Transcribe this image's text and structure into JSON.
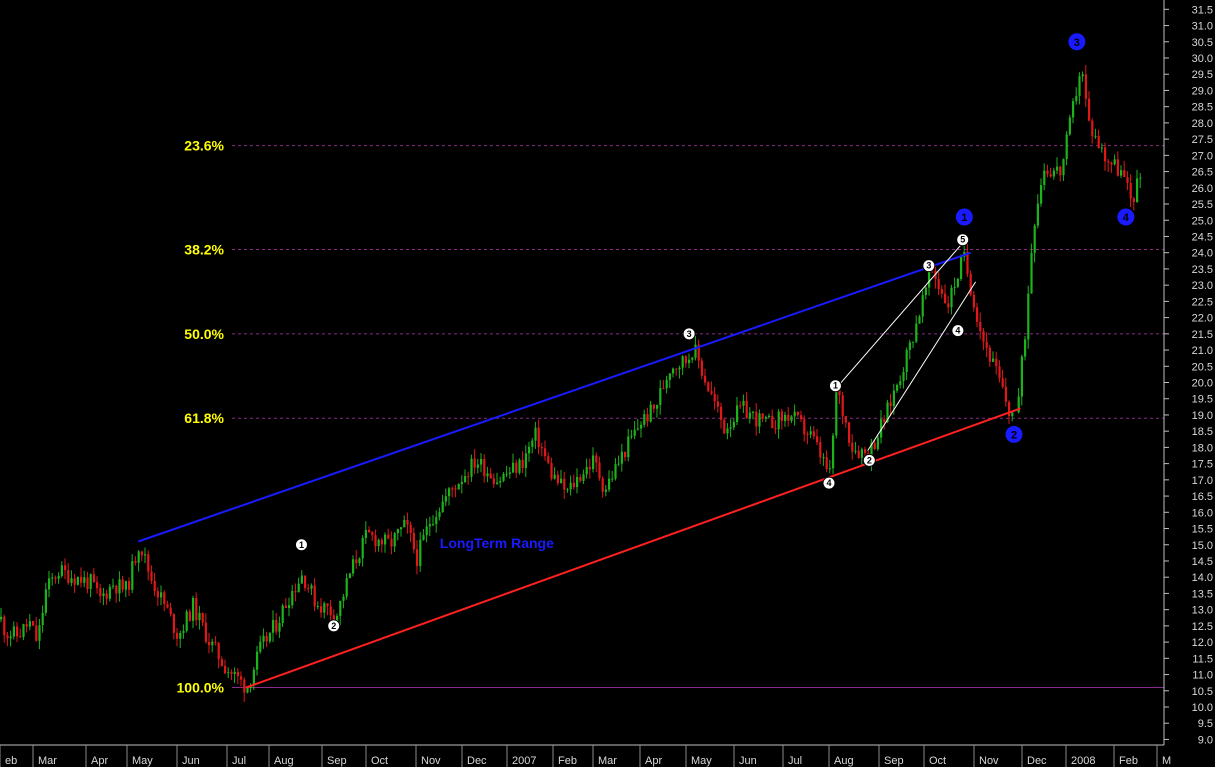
{
  "chart_data": {
    "type": "candlestick",
    "y_axis": {
      "ylim": [
        8.7,
        31.6
      ],
      "tick_labels": [
        "9.0",
        "9.5",
        "10.0",
        "10.5",
        "11.0",
        "11.5",
        "12.0",
        "12.5",
        "13.0",
        "13.5",
        "14.0",
        "14.5",
        "15.0",
        "15.5",
        "16.0",
        "16.5",
        "17.0",
        "17.5",
        "18.0",
        "18.5",
        "19.0",
        "19.5",
        "20.0",
        "20.5",
        "21.0",
        "21.5",
        "22.0",
        "22.5",
        "23.0",
        "23.5",
        "24.0",
        "24.5",
        "25.0",
        "25.5",
        "26.0",
        "26.5",
        "27.0",
        "27.5",
        "28.0",
        "28.5",
        "29.0",
        "29.5",
        "30.0",
        "30.5",
        "31.0",
        "31.5"
      ],
      "position": "right"
    },
    "x_axis": {
      "tick_labels": [
        {
          "label": "eb",
          "date": "2006-02-01"
        },
        {
          "label": "Mar",
          "date": "2006-03-01"
        },
        {
          "label": "Apr",
          "date": "2006-04-01"
        },
        {
          "label": "May",
          "date": "2006-05-01"
        },
        {
          "label": "Jun",
          "date": "2006-06-01"
        },
        {
          "label": "Jul",
          "date": "2006-07-01"
        },
        {
          "label": "Aug",
          "date": "2006-08-01"
        },
        {
          "label": "Sep",
          "date": "2006-09-01"
        },
        {
          "label": "Oct",
          "date": "2006-10-01"
        },
        {
          "label": "Nov",
          "date": "2006-11-01"
        },
        {
          "label": "Dec",
          "date": "2006-12-01"
        },
        {
          "label": "2007",
          "date": "2007-01-01"
        },
        {
          "label": "Feb",
          "date": "2007-02-01"
        },
        {
          "label": "Mar",
          "date": "2007-03-01"
        },
        {
          "label": "Apr",
          "date": "2007-04-01"
        },
        {
          "label": "May",
          "date": "2007-05-01"
        },
        {
          "label": "Jun",
          "date": "2007-06-01"
        },
        {
          "label": "Jul",
          "date": "2007-07-01"
        },
        {
          "label": "Aug",
          "date": "2007-08-01"
        },
        {
          "label": "Sep",
          "date": "2007-09-01"
        },
        {
          "label": "Oct",
          "date": "2007-10-01"
        },
        {
          "label": "Nov",
          "date": "2007-11-01"
        },
        {
          "label": "Dec",
          "date": "2007-12-01"
        },
        {
          "label": "2008",
          "date": "2008-01-01"
        },
        {
          "label": "Feb",
          "date": "2008-02-01"
        },
        {
          "label": "M",
          "date": "2008-03-01"
        }
      ]
    },
    "price_path": [
      {
        "date": "2006-01-20",
        "price": 14.0
      },
      {
        "date": "2006-01-27",
        "price": 13.0
      },
      {
        "date": "2006-02-05",
        "price": 12.3
      },
      {
        "date": "2006-02-15",
        "price": 12.2
      },
      {
        "date": "2006-02-25",
        "price": 12.6
      },
      {
        "date": "2006-03-03",
        "price": 12.0
      },
      {
        "date": "2006-03-08",
        "price": 13.6
      },
      {
        "date": "2006-03-15",
        "price": 14.2
      },
      {
        "date": "2006-03-25",
        "price": 14.0
      },
      {
        "date": "2006-04-05",
        "price": 13.8
      },
      {
        "date": "2006-04-10",
        "price": 13.3
      },
      {
        "date": "2006-04-20",
        "price": 13.8
      },
      {
        "date": "2006-04-30",
        "price": 13.6
      },
      {
        "date": "2006-05-08",
        "price": 15.1
      },
      {
        "date": "2006-05-15",
        "price": 14.0
      },
      {
        "date": "2006-05-25",
        "price": 13.0
      },
      {
        "date": "2006-06-01",
        "price": 12.2
      },
      {
        "date": "2006-06-10",
        "price": 13.1
      },
      {
        "date": "2006-06-20",
        "price": 12.0
      },
      {
        "date": "2006-06-30",
        "price": 11.2
      },
      {
        "date": "2006-07-10",
        "price": 10.8
      },
      {
        "date": "2006-07-15",
        "price": 10.6
      },
      {
        "date": "2006-07-25",
        "price": 11.8
      },
      {
        "date": "2006-08-05",
        "price": 12.6
      },
      {
        "date": "2006-08-12",
        "price": 13.4
      },
      {
        "date": "2006-08-20",
        "price": 14.1
      },
      {
        "date": "2006-08-28",
        "price": 13.2
      },
      {
        "date": "2006-09-05",
        "price": 13.0
      },
      {
        "date": "2006-09-10",
        "price": 12.8
      },
      {
        "date": "2006-09-20",
        "price": 14.2
      },
      {
        "date": "2006-10-01",
        "price": 15.3
      },
      {
        "date": "2006-10-15",
        "price": 15.0
      },
      {
        "date": "2006-10-25",
        "price": 15.6
      },
      {
        "date": "2006-11-01",
        "price": 14.6
      },
      {
        "date": "2006-11-10",
        "price": 15.8
      },
      {
        "date": "2006-11-25",
        "price": 16.8
      },
      {
        "date": "2006-12-10",
        "price": 17.6
      },
      {
        "date": "2006-12-25",
        "price": 17.0
      },
      {
        "date": "2007-01-10",
        "price": 17.5
      },
      {
        "date": "2007-01-20",
        "price": 18.4
      },
      {
        "date": "2007-01-30",
        "price": 17.2
      },
      {
        "date": "2007-02-10",
        "price": 16.6
      },
      {
        "date": "2007-02-20",
        "price": 17.2
      },
      {
        "date": "2007-03-01",
        "price": 17.6
      },
      {
        "date": "2007-03-08",
        "price": 16.7
      },
      {
        "date": "2007-03-20",
        "price": 17.8
      },
      {
        "date": "2007-04-01",
        "price": 18.8
      },
      {
        "date": "2007-04-10",
        "price": 19.2
      },
      {
        "date": "2007-04-20",
        "price": 20.5
      },
      {
        "date": "2007-05-01",
        "price": 20.7
      },
      {
        "date": "2007-05-05",
        "price": 21.1
      },
      {
        "date": "2007-05-15",
        "price": 19.8
      },
      {
        "date": "2007-05-25",
        "price": 18.6
      },
      {
        "date": "2007-06-05",
        "price": 19.2
      },
      {
        "date": "2007-06-20",
        "price": 18.7
      },
      {
        "date": "2007-07-05",
        "price": 19.0
      },
      {
        "date": "2007-07-20",
        "price": 18.3
      },
      {
        "date": "2007-08-01",
        "price": 17.1
      },
      {
        "date": "2007-08-05",
        "price": 19.8
      },
      {
        "date": "2007-08-15",
        "price": 18.0
      },
      {
        "date": "2007-08-25",
        "price": 17.8
      },
      {
        "date": "2007-09-05",
        "price": 19.0
      },
      {
        "date": "2007-09-20",
        "price": 21.0
      },
      {
        "date": "2007-10-05",
        "price": 23.5
      },
      {
        "date": "2007-10-15",
        "price": 22.4
      },
      {
        "date": "2007-10-25",
        "price": 23.9
      },
      {
        "date": "2007-11-05",
        "price": 21.5
      },
      {
        "date": "2007-11-15",
        "price": 20.2
      },
      {
        "date": "2007-11-23",
        "price": 19.0
      },
      {
        "date": "2007-11-28",
        "price": 19.4
      },
      {
        "date": "2007-12-03",
        "price": 21.8
      },
      {
        "date": "2007-12-08",
        "price": 24.8
      },
      {
        "date": "2007-12-15",
        "price": 26.6
      },
      {
        "date": "2007-12-28",
        "price": 26.5
      },
      {
        "date": "2008-01-05",
        "price": 28.5
      },
      {
        "date": "2008-01-10",
        "price": 29.8
      },
      {
        "date": "2008-01-15",
        "price": 28.0
      },
      {
        "date": "2008-01-25",
        "price": 27.0
      },
      {
        "date": "2008-02-05",
        "price": 26.5
      },
      {
        "date": "2008-02-12",
        "price": 25.6
      },
      {
        "date": "2008-02-20",
        "price": 26.6
      },
      {
        "date": "2008-02-28",
        "price": 26.9
      }
    ],
    "fib_levels": [
      {
        "label": "23.6%",
        "price": 27.3
      },
      {
        "label": "38.2%",
        "price": 24.1
      },
      {
        "label": "50.0%",
        "price": 21.5
      },
      {
        "label": "61.8%",
        "price": 18.9
      },
      {
        "label": "100.0%",
        "price": 10.6
      }
    ],
    "trendlines": [
      {
        "name": "upper",
        "color": "#1a1aff",
        "from": {
          "date": "2006-05-08",
          "price": 15.1
        },
        "to": {
          "date": "2007-10-30",
          "price": 24.0
        }
      },
      {
        "name": "lower",
        "color": "#ff2020",
        "from": {
          "date": "2006-07-15",
          "price": 10.6
        },
        "to": {
          "date": "2007-11-30",
          "price": 19.2
        }
      },
      {
        "name": "channel-a",
        "color": "#ffffff",
        "from": {
          "date": "2007-08-05",
          "price": 19.8
        },
        "to": {
          "date": "2007-10-25",
          "price": 24.3
        }
      },
      {
        "name": "channel-b",
        "color": "#ffffff",
        "from": {
          "date": "2007-08-25",
          "price": 17.9
        },
        "to": {
          "date": "2007-11-02",
          "price": 23.1
        }
      }
    ],
    "small_wave_labels": [
      {
        "label": "1",
        "date": "2006-08-20",
        "price": 15.0
      },
      {
        "label": "2",
        "date": "2006-09-09",
        "price": 12.5
      },
      {
        "label": "3",
        "date": "2007-05-03",
        "price": 21.5
      },
      {
        "label": "1",
        "date": "2007-08-05",
        "price": 19.9
      },
      {
        "label": "4",
        "date": "2007-08-01",
        "price": 16.9
      },
      {
        "label": "2",
        "date": "2007-08-26",
        "price": 17.6
      },
      {
        "label": "3",
        "date": "2007-10-04",
        "price": 23.6
      },
      {
        "label": "5",
        "date": "2007-10-25",
        "price": 24.4
      },
      {
        "label": "4",
        "date": "2007-10-22",
        "price": 21.6
      }
    ],
    "big_wave_labels": [
      {
        "label": "1",
        "date": "2007-10-26",
        "price": 25.1
      },
      {
        "label": "2",
        "date": "2007-11-26",
        "price": 18.4
      },
      {
        "label": "3",
        "date": "2008-01-08",
        "price": 30.5
      },
      {
        "label": "4",
        "date": "2008-02-09",
        "price": 25.1
      }
    ],
    "annotations": [
      {
        "text": "LongTerm Range",
        "date": "2006-12-25",
        "price": 14.9
      }
    ],
    "colors": {
      "background": "#000000",
      "up_candle": "#1db31d",
      "down_candle": "#e01818",
      "fib_line": "#8a2a8a",
      "fib_text": "#ffff00",
      "range_text": "#1a1aff",
      "wave_big": "#1a1aff"
    }
  }
}
